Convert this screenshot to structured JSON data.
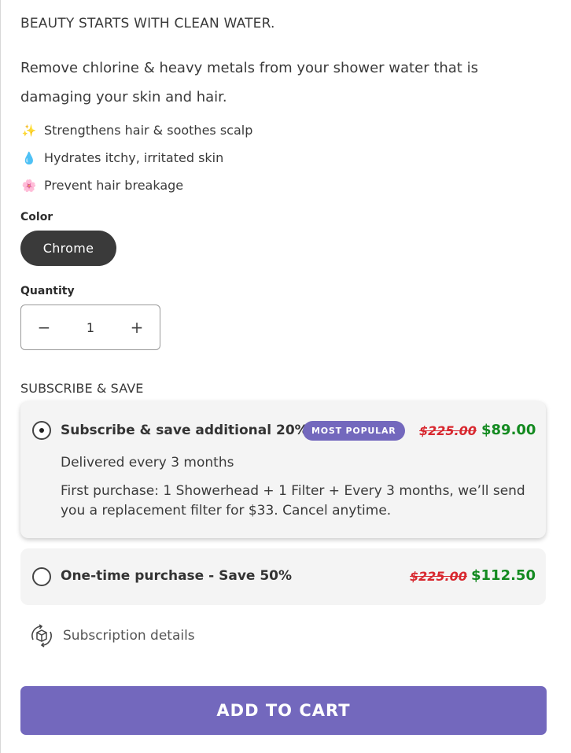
{
  "product": {
    "tagline": "BEAUTY STARTS WITH CLEAN WATER.",
    "description": "Remove chlorine & heavy metals from your shower water that is damaging your skin and hair.",
    "benefits": [
      {
        "icon": "sparkles-icon",
        "glyph": "✨",
        "text": "Strengthens hair & soothes scalp"
      },
      {
        "icon": "water-drop-icon",
        "glyph": "💧",
        "text": "Hydrates itchy, irritated skin"
      },
      {
        "icon": "flower-icon",
        "glyph": "🌸",
        "text": "Prevent hair breakage"
      }
    ]
  },
  "color": {
    "label": "Color",
    "selected": "Chrome"
  },
  "quantity": {
    "label": "Quantity",
    "value": "1",
    "decrease": "−",
    "increase": "+"
  },
  "subscription": {
    "heading": "SUBSCRIBE & SAVE",
    "options": [
      {
        "title": "Subscribe & save additional 20%",
        "badge": "MOST POPULAR",
        "old_price": "$225.00",
        "new_price": "$89.00",
        "frequency": "Delivered every 3 months",
        "details": "First purchase: 1 Showerhead + 1 Filter + Every 3 months, we’ll send you a replacement filter for $33. Cancel anytime.",
        "selected": true
      },
      {
        "title": "One-time purchase - Save 50%",
        "old_price": "$225.00",
        "new_price": "$112.50",
        "selected": false
      }
    ],
    "details_link": "Subscription details"
  },
  "cart": {
    "button_label": "ADD TO CART"
  },
  "colors": {
    "accent": "#7368bd",
    "price_green": "#138a20",
    "strike_red": "#d8282f",
    "pill_dark": "#3a3a3a"
  }
}
